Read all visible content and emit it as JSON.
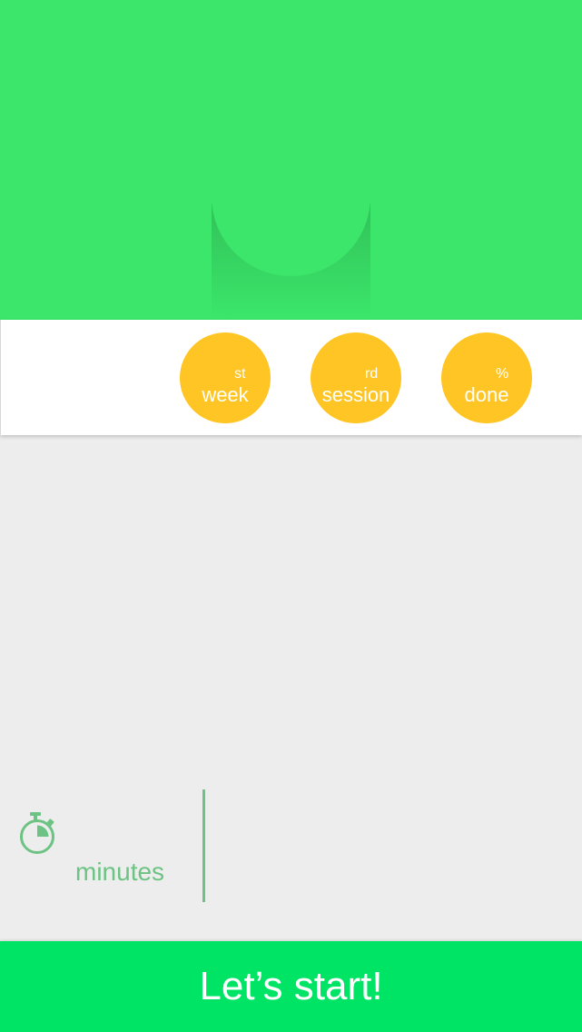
{
  "header": {
    "color": "#3be66a"
  },
  "stats": {
    "week": {
      "value": "",
      "suffix": "st",
      "caption": "week"
    },
    "session": {
      "value": "",
      "suffix": "rd",
      "caption": "session"
    },
    "done": {
      "value": "",
      "suffix": "%",
      "caption": "done"
    },
    "circle_color": "#fec524"
  },
  "workout": {
    "icon": "stopwatch-icon",
    "duration_value": "",
    "duration_unit": "minutes",
    "accent_color": "#6cc383"
  },
  "footer": {
    "start_label": "Let’s start!",
    "color": "#00e466"
  }
}
